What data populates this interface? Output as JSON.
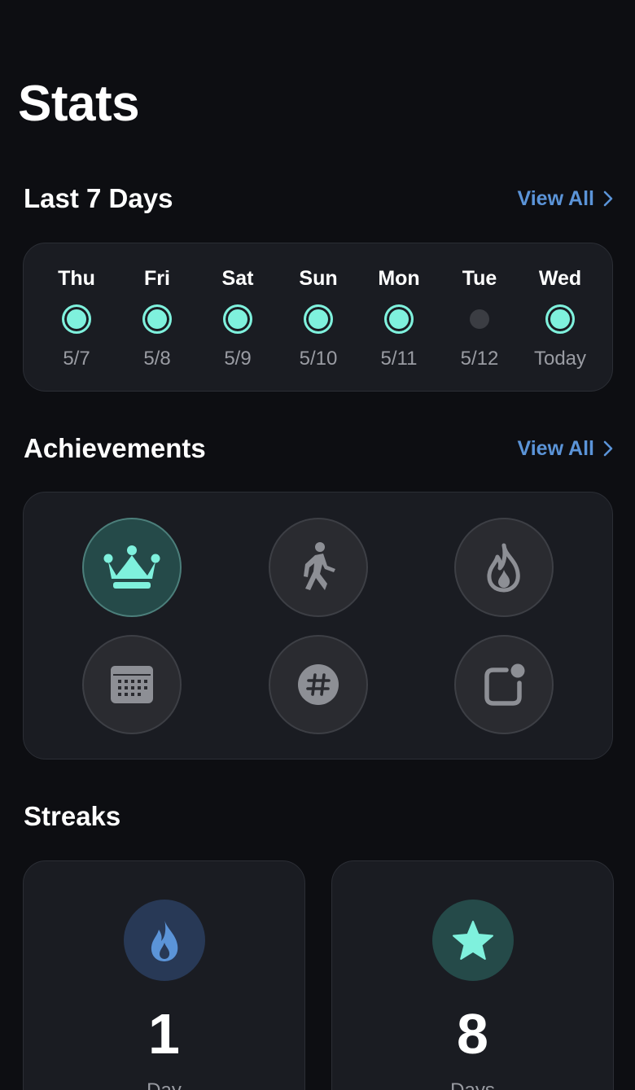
{
  "page": {
    "title": "Stats"
  },
  "last7": {
    "title": "Last 7 Days",
    "view_all": "View All",
    "days": [
      {
        "name": "Thu",
        "date": "5/7",
        "done": true
      },
      {
        "name": "Fri",
        "date": "5/8",
        "done": true
      },
      {
        "name": "Sat",
        "date": "5/9",
        "done": true
      },
      {
        "name": "Sun",
        "date": "5/10",
        "done": true
      },
      {
        "name": "Mon",
        "date": "5/11",
        "done": true
      },
      {
        "name": "Tue",
        "date": "5/12",
        "done": false
      },
      {
        "name": "Wed",
        "date": "Today",
        "done": true
      }
    ]
  },
  "achievements": {
    "title": "Achievements",
    "view_all": "View All",
    "badges": [
      {
        "icon": "crown-icon",
        "unlocked": true
      },
      {
        "icon": "walking-person-icon",
        "unlocked": false
      },
      {
        "icon": "flame-icon",
        "unlocked": false
      },
      {
        "icon": "calendar-icon",
        "unlocked": false
      },
      {
        "icon": "hashtag-icon",
        "unlocked": false
      },
      {
        "icon": "app-badge-icon",
        "unlocked": false
      }
    ]
  },
  "streaks": {
    "title": "Streaks",
    "items": [
      {
        "icon": "flame-icon",
        "value": "1",
        "unit": "Day"
      },
      {
        "icon": "star-icon",
        "value": "8",
        "unit": "Days"
      }
    ]
  },
  "colors": {
    "background": "#0d0e12",
    "card": "#1a1c22",
    "accent_teal": "#7ff1dd",
    "accent_blue": "#5b94d8",
    "muted_text": "#9a9ca3"
  }
}
